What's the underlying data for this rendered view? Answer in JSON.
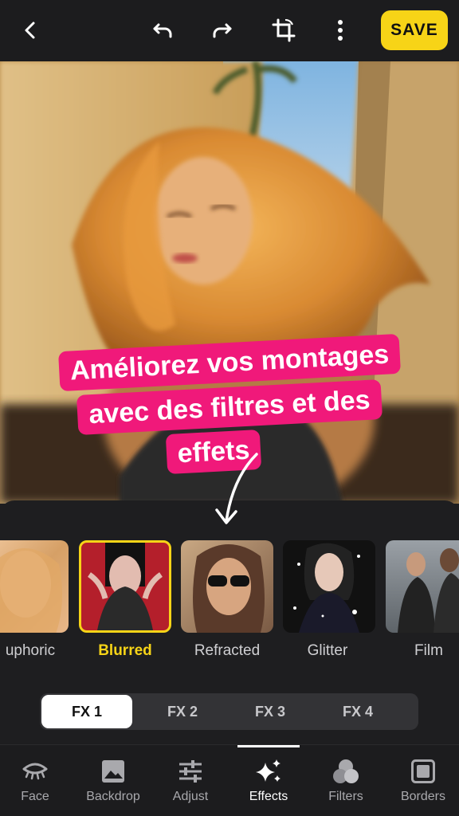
{
  "toolbar": {
    "save_label": "SAVE"
  },
  "promo": {
    "line1": "Améliorez vos montages",
    "line2": "avec des filtres et des",
    "line3": "effets"
  },
  "effects": [
    {
      "label": "uphoric"
    },
    {
      "label": "Blurred",
      "selected": true
    },
    {
      "label": "Refracted"
    },
    {
      "label": "Glitter"
    },
    {
      "label": "Film"
    }
  ],
  "fx_tabs": [
    {
      "label": "FX 1",
      "active": true
    },
    {
      "label": "FX 2"
    },
    {
      "label": "FX 3"
    },
    {
      "label": "FX 4"
    }
  ],
  "nav": [
    {
      "label": "Face",
      "icon": "eye-icon"
    },
    {
      "label": "Backdrop",
      "icon": "image-icon"
    },
    {
      "label": "Adjust",
      "icon": "sliders-icon"
    },
    {
      "label": "Effects",
      "icon": "sparkles-icon",
      "active": true
    },
    {
      "label": "Filters",
      "icon": "circles-icon"
    },
    {
      "label": "Borders",
      "icon": "square-frame-icon"
    }
  ],
  "colors": {
    "accent": "#f7d417",
    "promo_pink": "#f0197a",
    "background": "#1e1e20"
  }
}
